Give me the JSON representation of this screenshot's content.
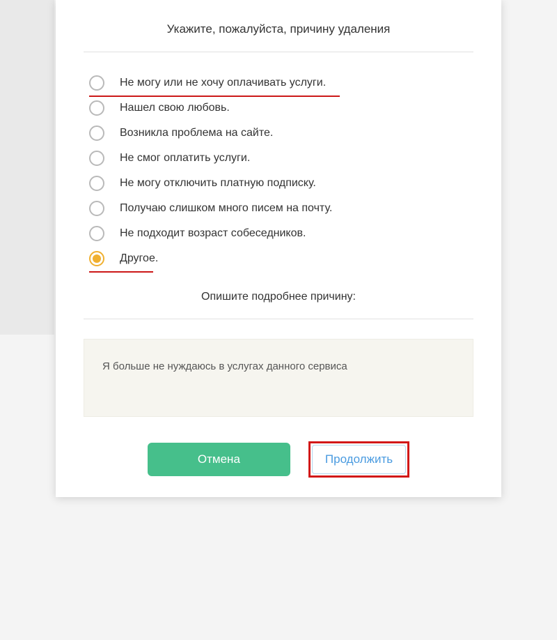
{
  "title": "Укажите, пожалуйста, причину удаления",
  "options": [
    {
      "label": "Не могу или не хочу оплачивать услуги.",
      "selected": false,
      "redUnderline": true,
      "ulClass": "ul1"
    },
    {
      "label": "Нашел свою любовь.",
      "selected": false
    },
    {
      "label": "Возникла проблема на сайте.",
      "selected": false
    },
    {
      "label": "Не смог оплатить услуги.",
      "selected": false
    },
    {
      "label": "Не могу отключить платную подписку.",
      "selected": false
    },
    {
      "label": "Получаю слишком много писем на почту.",
      "selected": false
    },
    {
      "label": "Не подходит возраст собеседников.",
      "selected": false
    },
    {
      "label": "Другое.",
      "selected": true,
      "redUnderline": true,
      "ulClass": "ul2"
    }
  ],
  "subtitle": "Опишите подробнее причину:",
  "textareaValue": "Я больше не нуждаюсь в услугах данного сервиса",
  "buttons": {
    "cancel": "Отмена",
    "continue": "Продолжить"
  }
}
